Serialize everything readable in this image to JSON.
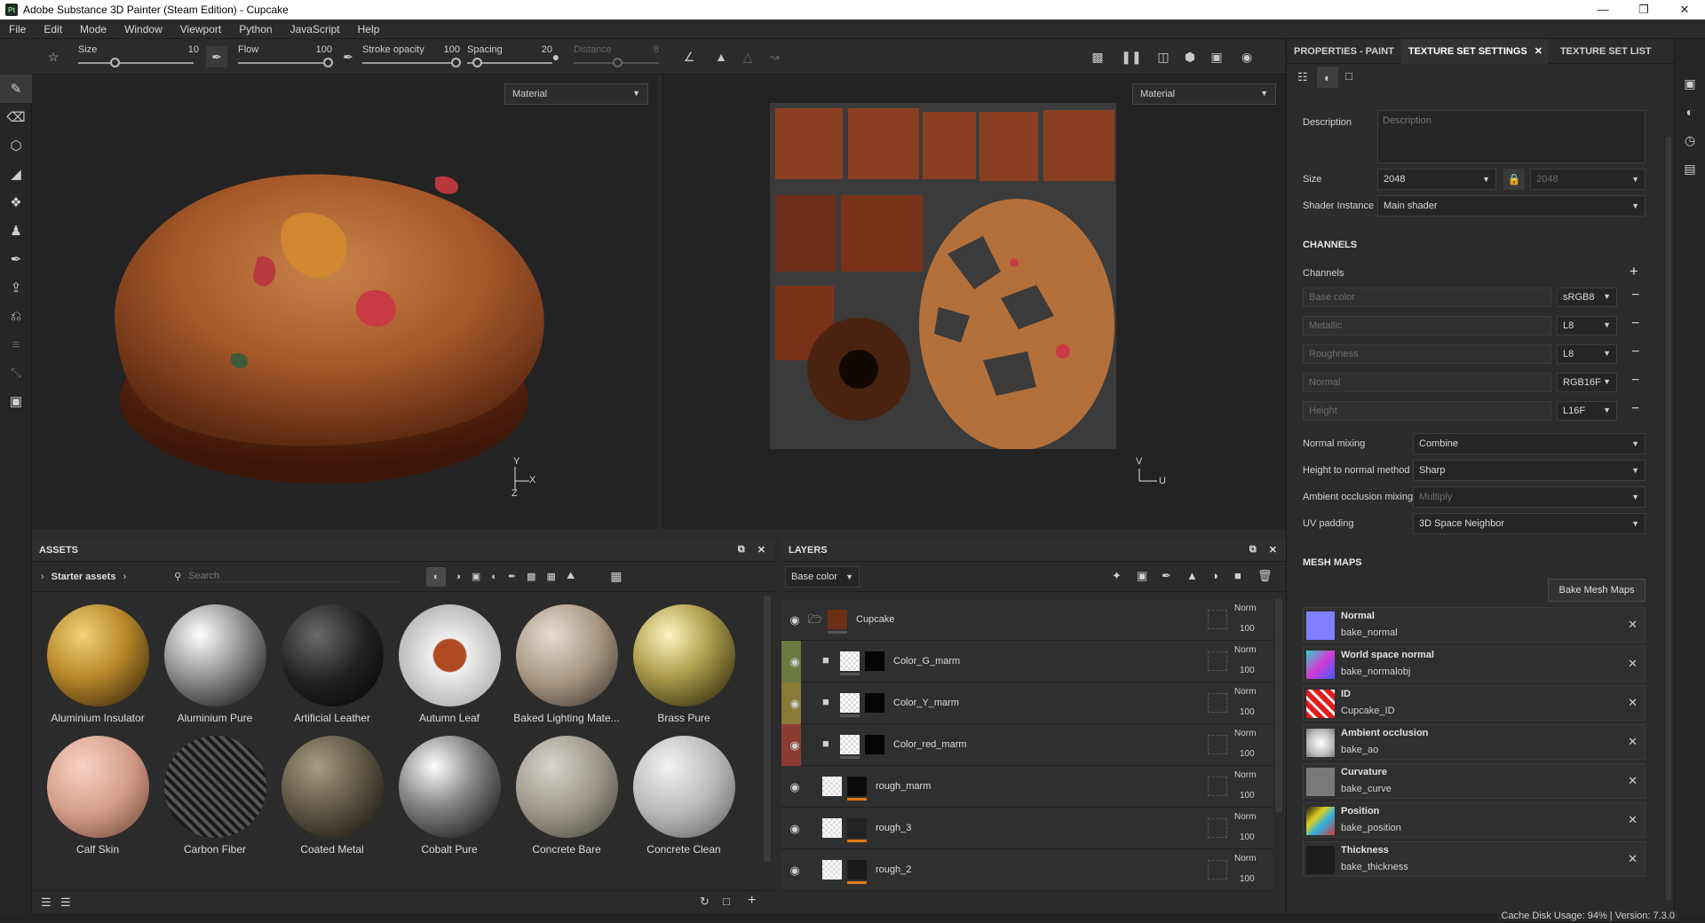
{
  "window": {
    "title": "Adobe Substance 3D Painter (Steam Edition) - Cupcake",
    "logo": "Pt"
  },
  "menu": [
    "File",
    "Edit",
    "Mode",
    "Window",
    "Viewport",
    "Python",
    "JavaScript",
    "Help"
  ],
  "tool_options": {
    "size_label": "Size",
    "size_value": "10",
    "flow_label": "Flow",
    "flow_value": "100",
    "stroke_label": "Stroke opacity",
    "stroke_value": "100",
    "spacing_label": "Spacing",
    "spacing_value": "20",
    "distance_label": "Distance",
    "distance_value": "8"
  },
  "viewports": {
    "left_mode": "Material",
    "right_mode": "Material"
  },
  "axes": {
    "y": "Y",
    "x": "X",
    "z": "Z",
    "v": "V",
    "u": "U"
  },
  "assets": {
    "title": "ASSETS",
    "breadcrumb": "Starter assets",
    "search_placeholder": "Search",
    "items": [
      "Aluminium Insulator",
      "Aluminium Pure",
      "Artificial Leather",
      "Autumn Leaf",
      "Baked Lighting Mate...",
      "Brass Pure",
      "Calf Skin",
      "Carbon Fiber",
      "Coated Metal",
      "Cobalt Pure",
      "Concrete Bare",
      "Concrete Clean"
    ]
  },
  "layers": {
    "title": "LAYERS",
    "channel": "Base color",
    "rows": [
      {
        "name": "Cupcake",
        "blend": "Norm",
        "opacity": "100"
      },
      {
        "name": "Color_G_marm",
        "blend": "Norm",
        "opacity": "100"
      },
      {
        "name": "Color_Y_marm",
        "blend": "Norm",
        "opacity": "100"
      },
      {
        "name": "Color_red_marm",
        "blend": "Norm",
        "opacity": "100"
      },
      {
        "name": "rough_marm",
        "blend": "Norm",
        "opacity": "100"
      },
      {
        "name": "rough_3",
        "blend": "Norm",
        "opacity": "100"
      },
      {
        "name": "rough_2",
        "blend": "Norm",
        "opacity": "100"
      }
    ]
  },
  "right_panel": {
    "tabs": [
      "PROPERTIES - PAINT",
      "TEXTURE SET SETTINGS",
      "TEXTURE SET LIST"
    ],
    "description_label": "Description",
    "description_placeholder": "Description",
    "size_label": "Size",
    "size_value": "2048",
    "size_value_locked": "2048",
    "shader_label": "Shader Instance",
    "shader_value": "Main shader",
    "channels_section": "CHANNELS",
    "channels_label": "Channels",
    "channels": [
      {
        "name": "Base color",
        "format": "sRGB8"
      },
      {
        "name": "Metallic",
        "format": "L8"
      },
      {
        "name": "Roughness",
        "format": "L8"
      },
      {
        "name": "Normal",
        "format": "RGB16F"
      },
      {
        "name": "Height",
        "format": "L16F"
      }
    ],
    "normal_mixing_label": "Normal mixing",
    "normal_mixing_value": "Combine",
    "height_normal_label": "Height to normal method",
    "height_normal_value": "Sharp",
    "ao_mixing_label": "Ambient occlusion mixing",
    "ao_mixing_value": "Multiply",
    "uv_padding_label": "UV padding",
    "uv_padding_value": "3D Space Neighbor",
    "mesh_maps_section": "MESH MAPS",
    "bake_button": "Bake Mesh Maps",
    "mesh_maps": [
      {
        "title": "Normal",
        "file": "bake_normal"
      },
      {
        "title": "World space normal",
        "file": "bake_normalobj"
      },
      {
        "title": "ID",
        "file": "Cupcake_ID"
      },
      {
        "title": "Ambient occlusion",
        "file": "bake_ao"
      },
      {
        "title": "Curvature",
        "file": "bake_curve"
      },
      {
        "title": "Position",
        "file": "bake_position"
      },
      {
        "title": "Thickness",
        "file": "bake_thickness"
      }
    ]
  },
  "status": {
    "text": "Cache Disk Usage:   94% | Version: 7.3.0"
  },
  "colors": {
    "accent_green": "#6b7a3e",
    "accent_yellow": "#8a7a36",
    "accent_red": "#8c3b32",
    "roughness_bar": "#e07a12"
  }
}
